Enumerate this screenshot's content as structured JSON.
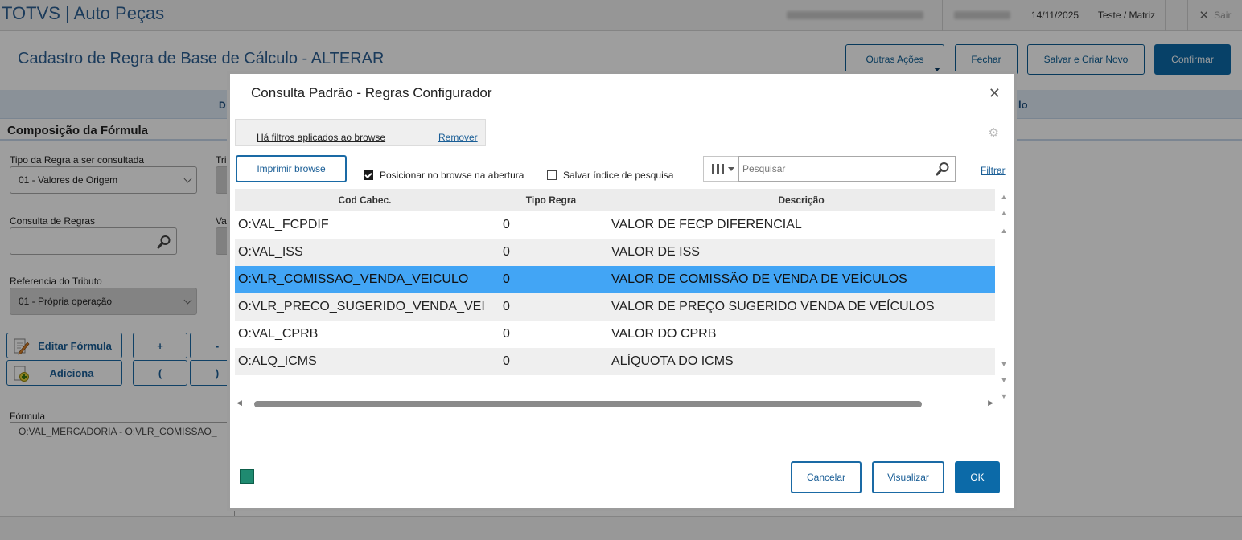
{
  "app": {
    "title": "TOTVS | Auto Peças",
    "date": "14/11/2025",
    "branch": "Teste / Matriz",
    "logout_label": "Sair"
  },
  "page": {
    "title": "Cadastro de Regra de Base de Cálculo - ALTERAR",
    "actions": {
      "other": "Outras Ações",
      "close": "Fechar",
      "save_new": "Salvar e Criar Novo",
      "confirm": "Confirmar"
    },
    "tab_left_label": "D",
    "tab_right_label": "lo"
  },
  "form": {
    "section_title": "Composição da Fórmula",
    "rule_type_label": "Tipo da Regra a ser consultada",
    "rule_type_value": "01 - Valores de Origem",
    "side_label_1": "Tri",
    "query_label": "Consulta de Regras",
    "query_value": "",
    "side_label_2": "Va",
    "tribute_ref_label": "Referencia do Tributo",
    "tribute_ref_value": "01 - Própria operação",
    "edit_formula": "Editar Fórmula",
    "add": "Adiciona",
    "op_plus": "+",
    "op_minus": "-",
    "op_open": "(",
    "op_close": ")",
    "formula_label": "Fórmula",
    "formula_value": "O:VAL_MERCADORIA - O:VLR_COMISSAO_"
  },
  "dialog": {
    "title": "Consulta Padrão - Regras Configurador",
    "filter_notice": "Há filtros aplicados ao browse",
    "remove": "Remover",
    "print_browse": "Imprimir browse",
    "position_on_open": "Posicionar no browse na abertura",
    "position_checked": true,
    "save_index": "Salvar índice de pesquisa",
    "save_index_checked": false,
    "search_placeholder": "Pesquisar",
    "filter": "Filtrar",
    "columns": [
      "Cod Cabec.",
      "Tipo Regra",
      "Descrição"
    ],
    "rows": [
      {
        "code": "O:VAL_FCPDIF",
        "type": "0",
        "desc": "VALOR DE FECP DIFERENCIAL"
      },
      {
        "code": "O:VAL_ISS",
        "type": "0",
        "desc": "VALOR DE ISS"
      },
      {
        "code": "O:VLR_COMISSAO_VENDA_VEICULO",
        "type": "0",
        "desc": "VALOR DE COMISSÃO DE VENDA DE VEÍCULOS"
      },
      {
        "code": "O:VLR_PRECO_SUGERIDO_VENDA_VEI",
        "type": "0",
        "desc": "VALOR DE PREÇO SUGERIDO VENDA DE VEÍCULOS"
      },
      {
        "code": "O:VAL_CPRB",
        "type": "0",
        "desc": "VALOR DO CPRB"
      },
      {
        "code": "O:ALQ_ICMS",
        "type": "0",
        "desc": "ALÍQUOTA DO ICMS"
      }
    ],
    "selected_row": 2,
    "cancel": "Cancelar",
    "view": "Visualizar",
    "ok": "OK"
  },
  "colors": {
    "primary": "#0c6aa8",
    "selected_row": "#42a5f5",
    "title_blue": "#2d5f93"
  }
}
